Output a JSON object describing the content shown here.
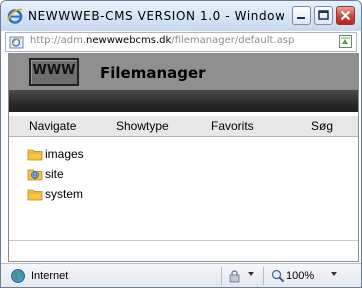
{
  "window": {
    "title": "NEWWWEB-CMS VERSION 1.0 - Window...",
    "controls": [
      "minimize-icon",
      "maximize-icon",
      "close-icon"
    ]
  },
  "address_bar": {
    "url_prefix": "http://adm.",
    "url_domain": "newwwebcms.dk",
    "url_path": "/filemanager/default.asp"
  },
  "header": {
    "logo_text": "WWW",
    "title": "Filemanager"
  },
  "nav": {
    "items": [
      "Navigate",
      "Showtype",
      "Favorits",
      "Søg"
    ]
  },
  "tree": {
    "items": [
      {
        "label": "images",
        "icon": "folder-icon"
      },
      {
        "label": "site",
        "icon": "web-folder-icon"
      },
      {
        "label": "system",
        "icon": "folder-icon"
      }
    ]
  },
  "status_bar": {
    "zone": "Internet",
    "zoom": "100%"
  },
  "colors": {
    "header_gray": "#8f8f8f",
    "dark_band": "#2b2b2b",
    "nav_bg": "#e7e7e7",
    "folder_yellow": "#f6c342"
  }
}
